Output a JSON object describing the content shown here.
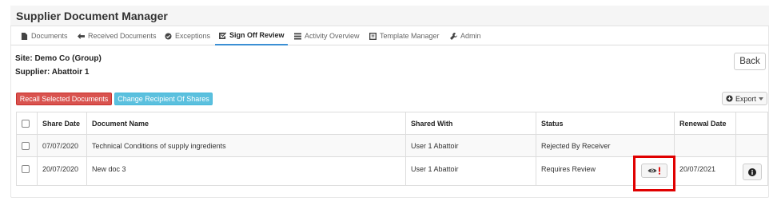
{
  "app": {
    "title": "Supplier Document Manager"
  },
  "nav": [
    {
      "label": "Documents",
      "icon": "document-icon",
      "active": false
    },
    {
      "label": "Received Documents",
      "icon": "arrow-left-icon",
      "active": false
    },
    {
      "label": "Exceptions",
      "icon": "check-circle-icon",
      "active": false
    },
    {
      "label": "Sign Off Review",
      "icon": "check-square-icon",
      "active": true
    },
    {
      "label": "Activity Overview",
      "icon": "list-icon",
      "active": false
    },
    {
      "label": "Template Manager",
      "icon": "template-icon",
      "active": false
    },
    {
      "label": "Admin",
      "icon": "wrench-icon",
      "active": false
    }
  ],
  "context": {
    "site": "Site: Demo Co (Group)",
    "supplier": "Supplier: Abattoir 1"
  },
  "buttons": {
    "back": "Back",
    "recall": "Recall Selected Documents",
    "change_recipient": "Change Recipient Of Shares",
    "export": "Export"
  },
  "table": {
    "headers": [
      "Share Date",
      "Document Name",
      "Shared With",
      "Status",
      "Renewal Date"
    ],
    "rows": [
      {
        "share_date": "07/07/2020",
        "document_name": "Technical Conditions of supply ingredients",
        "shared_with": "User 1 Abattoir",
        "status": "Rejected By Receiver",
        "renewal_date": ""
      },
      {
        "share_date": "20/07/2020",
        "document_name": "New doc 3",
        "shared_with": "User 1 Abattoir",
        "status": "Requires Review",
        "renewal_date": "20/07/2021"
      }
    ]
  },
  "colors": {
    "danger": "#d9534f",
    "info": "#5bc0de",
    "active_tab": "#3b8fd4",
    "highlight": "#e00000"
  }
}
